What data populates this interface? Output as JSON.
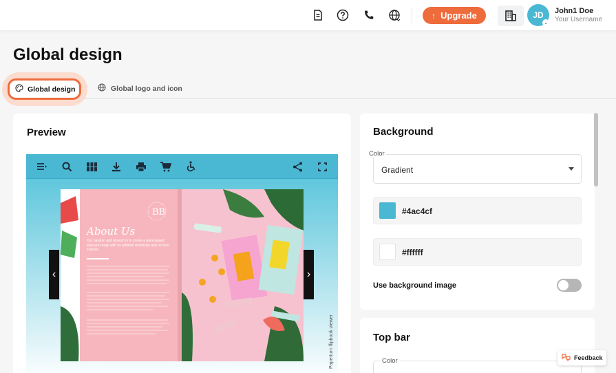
{
  "header": {
    "icons": [
      "document-icon",
      "help-icon",
      "phone-icon",
      "globe-icon"
    ],
    "upgrade_label": "Upgrade",
    "avatar_initials": "JD",
    "user_name": "John1 Doe",
    "user_sub": "Your Username"
  },
  "page": {
    "title": "Global design",
    "tabs": [
      {
        "label": "Global design",
        "icon": "palette-icon",
        "active": true
      },
      {
        "label": "Global logo and icon",
        "icon": "globe-icon",
        "active": false
      }
    ]
  },
  "preview": {
    "title": "Preview",
    "credit": "Paperturn flipbook viewer",
    "about_title": "About Us",
    "about_text": "Our passion and mission is to create a plant-based skincare range with no artificial chemicals and no face science"
  },
  "background": {
    "title": "Background",
    "color_label": "Color",
    "color_value": "Gradient",
    "color1": "#4ac4cf",
    "color2": "#ffffff",
    "use_bg_image_label": "Use background image",
    "use_bg_image": false
  },
  "topbar": {
    "title": "Top bar",
    "color_label": "Color"
  },
  "feedback_label": "Feedback",
  "colors": {
    "accent": "#ee6b3b",
    "avatar": "#4ab8d2",
    "toolbar": "#4ab8d2"
  }
}
